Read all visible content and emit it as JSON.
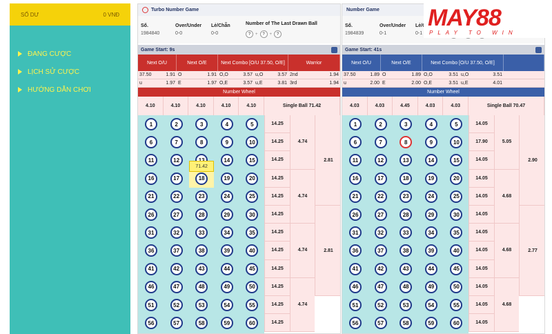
{
  "sidebar": {
    "balance_label": "SỐ DƯ",
    "balance_value": "0 VNĐ",
    "items": [
      {
        "label": "ĐANG CƯỢC"
      },
      {
        "label": "LỊCH SỬ CƯỢC"
      },
      {
        "label": "HƯỚNG DẪN CHƠI"
      }
    ]
  },
  "logo": {
    "main": "MAY88",
    "sub": "PLAY TO WIN"
  },
  "left": {
    "title": "Turbo Number Game",
    "so_label": "Số.",
    "so_value": "1984840",
    "ou_label": "Over/Under",
    "ou_value": "0-0",
    "lc_label": "Lẻ/Chẵn",
    "lc_value": "0-0",
    "last_label": "Number of The Last Drawn Ball",
    "last_balls": [
      "?",
      "?",
      "?"
    ],
    "game_start": "Game Start: 9s",
    "heads": [
      "Next O/U",
      "Next O/E",
      "Next Combo [O/U 37.50, O/E]",
      "Warrior"
    ],
    "odds_rows": [
      [
        "37.50",
        "1.91",
        "O",
        "1.91",
        "O,O",
        "3.57",
        "u,O",
        "3.57",
        "2nd",
        "1.94"
      ],
      [
        "u",
        "1.97",
        "E",
        "1.97",
        "O,E",
        "3.57",
        "u,E",
        "3.81",
        "3rd",
        "1.94"
      ]
    ],
    "wheel_label": "Number Wheel",
    "sums": [
      "4.10",
      "4.10",
      "4.10",
      "4.10",
      "4.10"
    ],
    "single_ball": "Single Ball  71.42",
    "row_odds": [
      "14.25",
      "14.25",
      "14.25",
      "14.25",
      "14.25",
      "14.25",
      "14.25",
      "14.25",
      "14.25",
      "14.25",
      "14.25",
      "14.25"
    ],
    "grp2": [
      "4.74",
      "4.74",
      "4.74",
      "4.74"
    ],
    "grp5": [
      "2.81",
      "2.81"
    ],
    "tooltip": "71.42"
  },
  "right": {
    "title": "Number Game",
    "so_label": "Số.",
    "so_value": "1984839",
    "ou_label": "Over/Under",
    "ou_value": "0-1",
    "lc_label": "Lẻ/Chẵn",
    "lc_value": "0-1",
    "last_balls": [
      "8",
      "?",
      "?"
    ],
    "game_start": "Game Start: 41s",
    "heads": [
      "Next O/U",
      "Next O/E",
      "Next Combo [O/U 37.50, O/E]"
    ],
    "odds_rows": [
      [
        "37.50",
        "1.89",
        "O",
        "1.89",
        "O,O",
        "3.51",
        "u,O",
        "3.51"
      ],
      [
        "u",
        "2.00",
        "E",
        "2.00",
        "O,E",
        "3.51",
        "u,E",
        "4.01"
      ]
    ],
    "wheel_label": "Number Wheel",
    "sums": [
      "4.03",
      "4.03",
      "4.45",
      "4.03",
      "4.03"
    ],
    "single_ball": "Single Ball  70.47",
    "row_odds": [
      "14.05",
      "17.90",
      "14.05",
      "14.05",
      "14.05",
      "14.05",
      "14.05",
      "14.05",
      "14.05",
      "14.05",
      "14.05",
      "14.05"
    ],
    "grp2": [
      "5.05",
      "4.68",
      "4.68",
      "4.68"
    ],
    "grp5": [
      "2.90",
      "2.77"
    ],
    "hit_ball": 8
  }
}
